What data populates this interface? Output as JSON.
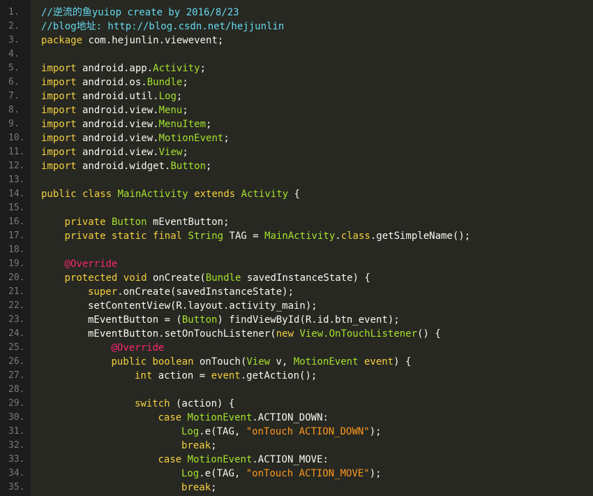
{
  "colors": {
    "background": "#272822",
    "gutter": "#1c1c1c",
    "line_number": "#7a7a7a",
    "comment": "#66d9ef",
    "keyword": "#f4d03f",
    "type": "#a6e22e",
    "string": "#fd971f",
    "annotation": "#f92672",
    "plain": "#f8f8f2"
  },
  "lines": [
    {
      "n": "1.",
      "indent": 0,
      "tokens": [
        [
          "comment",
          "//逆流的鱼yuiop create by 2016/8/23"
        ]
      ]
    },
    {
      "n": "2.",
      "indent": 0,
      "tokens": [
        [
          "comment",
          "//blog地址: http://blog.csdn.net/hejjunlin"
        ]
      ]
    },
    {
      "n": "3.",
      "indent": 0,
      "tokens": [
        [
          "kw",
          "package"
        ],
        [
          "plain",
          " com.hejunlin.viewevent;"
        ]
      ]
    },
    {
      "n": "4.",
      "indent": 0,
      "tokens": []
    },
    {
      "n": "5.",
      "indent": 0,
      "tokens": [
        [
          "kw",
          "import"
        ],
        [
          "plain",
          " android.app."
        ],
        [
          "type",
          "Activity"
        ],
        [
          "plain",
          ";"
        ]
      ]
    },
    {
      "n": "6.",
      "indent": 0,
      "tokens": [
        [
          "kw",
          "import"
        ],
        [
          "plain",
          " android.os."
        ],
        [
          "type",
          "Bundle"
        ],
        [
          "plain",
          ";"
        ]
      ]
    },
    {
      "n": "7.",
      "indent": 0,
      "tokens": [
        [
          "kw",
          "import"
        ],
        [
          "plain",
          " android.util."
        ],
        [
          "type",
          "Log"
        ],
        [
          "plain",
          ";"
        ]
      ]
    },
    {
      "n": "8.",
      "indent": 0,
      "tokens": [
        [
          "kw",
          "import"
        ],
        [
          "plain",
          " android.view."
        ],
        [
          "type",
          "Menu"
        ],
        [
          "plain",
          ";"
        ]
      ]
    },
    {
      "n": "9.",
      "indent": 0,
      "tokens": [
        [
          "kw",
          "import"
        ],
        [
          "plain",
          " android.view."
        ],
        [
          "type",
          "MenuItem"
        ],
        [
          "plain",
          ";"
        ]
      ]
    },
    {
      "n": "10.",
      "indent": 0,
      "tokens": [
        [
          "kw",
          "import"
        ],
        [
          "plain",
          " android.view."
        ],
        [
          "type",
          "MotionEvent"
        ],
        [
          "plain",
          ";"
        ]
      ]
    },
    {
      "n": "11.",
      "indent": 0,
      "tokens": [
        [
          "kw",
          "import"
        ],
        [
          "plain",
          " android.view."
        ],
        [
          "type",
          "View"
        ],
        [
          "plain",
          ";"
        ]
      ]
    },
    {
      "n": "12.",
      "indent": 0,
      "tokens": [
        [
          "kw",
          "import"
        ],
        [
          "plain",
          " android.widget."
        ],
        [
          "type",
          "Button"
        ],
        [
          "plain",
          ";"
        ]
      ]
    },
    {
      "n": "13.",
      "indent": 0,
      "tokens": []
    },
    {
      "n": "14.",
      "indent": 0,
      "tokens": [
        [
          "kw",
          "public class"
        ],
        [
          "plain",
          " "
        ],
        [
          "type",
          "MainActivity"
        ],
        [
          "plain",
          " "
        ],
        [
          "kw",
          "extends"
        ],
        [
          "plain",
          " "
        ],
        [
          "type",
          "Activity"
        ],
        [
          "plain",
          " {"
        ]
      ]
    },
    {
      "n": "15.",
      "indent": 0,
      "tokens": []
    },
    {
      "n": "16.",
      "indent": 1,
      "tokens": [
        [
          "kw",
          "private"
        ],
        [
          "plain",
          " "
        ],
        [
          "type",
          "Button"
        ],
        [
          "plain",
          " mEventButton;"
        ]
      ]
    },
    {
      "n": "17.",
      "indent": 1,
      "tokens": [
        [
          "kw",
          "private static final"
        ],
        [
          "plain",
          " "
        ],
        [
          "type",
          "String"
        ],
        [
          "plain",
          " TAG = "
        ],
        [
          "type",
          "MainActivity"
        ],
        [
          "plain",
          "."
        ],
        [
          "kw",
          "class"
        ],
        [
          "plain",
          ".getSimpleName();"
        ]
      ]
    },
    {
      "n": "18.",
      "indent": 0,
      "tokens": []
    },
    {
      "n": "19.",
      "indent": 1,
      "tokens": [
        [
          "anno",
          "@Override"
        ]
      ]
    },
    {
      "n": "20.",
      "indent": 1,
      "tokens": [
        [
          "kw",
          "protected void"
        ],
        [
          "plain",
          " onCreate("
        ],
        [
          "type",
          "Bundle"
        ],
        [
          "plain",
          " savedInstanceState) {"
        ]
      ]
    },
    {
      "n": "21.",
      "indent": 2,
      "tokens": [
        [
          "kw",
          "super"
        ],
        [
          "plain",
          ".onCreate(savedInstanceState);"
        ]
      ]
    },
    {
      "n": "22.",
      "indent": 2,
      "tokens": [
        [
          "plain",
          "setContentView(R.layout.activity_main);"
        ]
      ]
    },
    {
      "n": "23.",
      "indent": 2,
      "tokens": [
        [
          "plain",
          "mEventButton = ("
        ],
        [
          "type",
          "Button"
        ],
        [
          "plain",
          ") findViewById(R.id.btn_event);"
        ]
      ]
    },
    {
      "n": "24.",
      "indent": 2,
      "tokens": [
        [
          "plain",
          "mEventButton.setOnTouchListener("
        ],
        [
          "kw",
          "new"
        ],
        [
          "plain",
          " "
        ],
        [
          "type",
          "View.OnTouchListener"
        ],
        [
          "plain",
          "() {"
        ]
      ]
    },
    {
      "n": "25.",
      "indent": 3,
      "tokens": [
        [
          "anno",
          "@Override"
        ]
      ]
    },
    {
      "n": "26.",
      "indent": 3,
      "tokens": [
        [
          "kw",
          "public boolean"
        ],
        [
          "plain",
          " onTouch("
        ],
        [
          "type",
          "View"
        ],
        [
          "plain",
          " v, "
        ],
        [
          "type",
          "MotionEvent"
        ],
        [
          "plain",
          " "
        ],
        [
          "kw",
          "event"
        ],
        [
          "plain",
          ") {"
        ]
      ]
    },
    {
      "n": "27.",
      "indent": 4,
      "tokens": [
        [
          "kw",
          "int"
        ],
        [
          "plain",
          " action = "
        ],
        [
          "kw",
          "event"
        ],
        [
          "plain",
          ".getAction();"
        ]
      ]
    },
    {
      "n": "28.",
      "indent": 0,
      "tokens": []
    },
    {
      "n": "29.",
      "indent": 4,
      "tokens": [
        [
          "kw",
          "switch"
        ],
        [
          "plain",
          " (action) {"
        ]
      ]
    },
    {
      "n": "30.",
      "indent": 5,
      "tokens": [
        [
          "kw",
          "case"
        ],
        [
          "plain",
          " "
        ],
        [
          "type",
          "MotionEvent"
        ],
        [
          "plain",
          ".ACTION_DOWN:"
        ]
      ]
    },
    {
      "n": "31.",
      "indent": 6,
      "tokens": [
        [
          "type",
          "Log"
        ],
        [
          "plain",
          ".e(TAG, "
        ],
        [
          "str",
          "\"onTouch ACTION_DOWN\""
        ],
        [
          "plain",
          ");"
        ]
      ]
    },
    {
      "n": "32.",
      "indent": 6,
      "tokens": [
        [
          "kw",
          "break"
        ],
        [
          "plain",
          ";"
        ]
      ]
    },
    {
      "n": "33.",
      "indent": 5,
      "tokens": [
        [
          "kw",
          "case"
        ],
        [
          "plain",
          " "
        ],
        [
          "type",
          "MotionEvent"
        ],
        [
          "plain",
          ".ACTION_MOVE:"
        ]
      ]
    },
    {
      "n": "34.",
      "indent": 6,
      "tokens": [
        [
          "type",
          "Log"
        ],
        [
          "plain",
          ".e(TAG, "
        ],
        [
          "str",
          "\"onTouch ACTION_MOVE\""
        ],
        [
          "plain",
          ");"
        ]
      ]
    },
    {
      "n": "35.",
      "indent": 6,
      "tokens": [
        [
          "kw",
          "break"
        ],
        [
          "plain",
          ";"
        ]
      ]
    }
  ]
}
